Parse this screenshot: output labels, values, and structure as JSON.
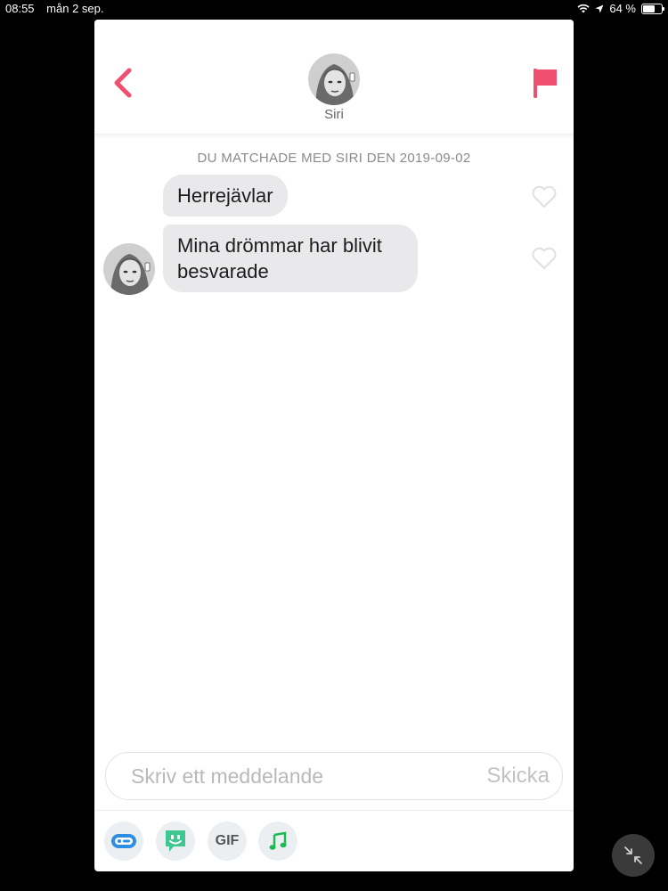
{
  "status_bar": {
    "time": "08:55",
    "date": "mån 2 sep.",
    "battery": "64 %",
    "battery_level": 0.64
  },
  "header": {
    "back_icon": "chevron-left-icon",
    "name": "Siri",
    "report_icon": "flag-icon",
    "accent_color": "#f0506e"
  },
  "conversation": {
    "match_text": "DU MATCHADE MED SIRI DEN 2019-09-02",
    "messages": [
      {
        "text": "Herrejävlar",
        "liked": false
      },
      {
        "text": "Mina drömmar har blivit besvarade",
        "liked": false
      }
    ]
  },
  "composer": {
    "placeholder": "Skriv ett meddelande",
    "send_label": "Skicka"
  },
  "toolbar": {
    "tools": [
      {
        "icon": "sticker-bubble-icon",
        "color": "#2f8de4"
      },
      {
        "icon": "bitmoji-icon",
        "color": "#3fc792"
      },
      {
        "label": "GIF"
      },
      {
        "icon": "music-note-icon",
        "color": "#1db954"
      }
    ]
  }
}
